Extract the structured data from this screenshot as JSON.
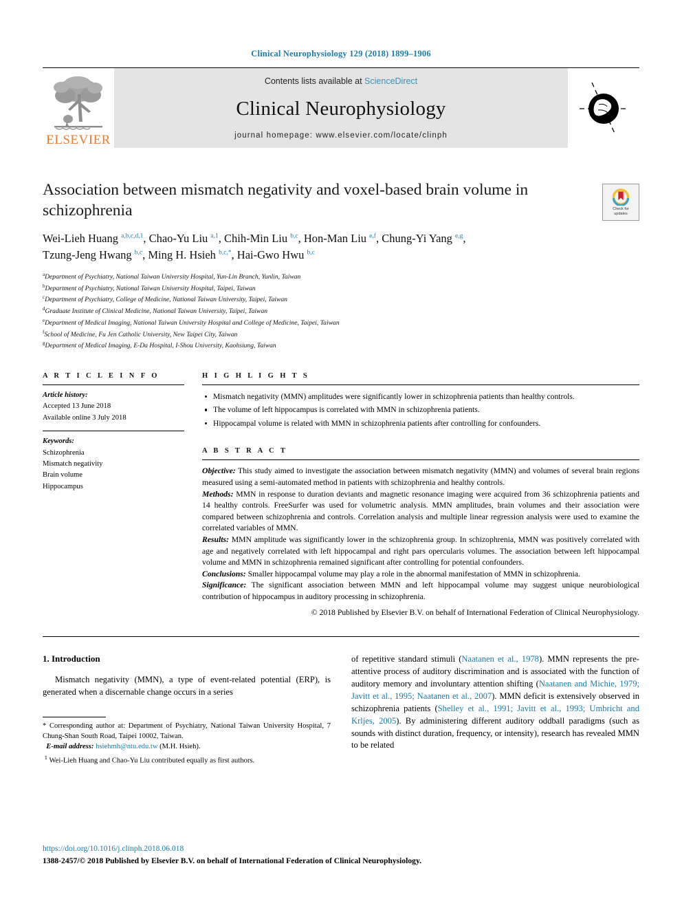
{
  "running_head": "Clinical Neurophysiology 129 (2018) 1899–1906",
  "masthead": {
    "contents_prefix": "Contents lists available at ",
    "sciencedirect": "ScienceDirect",
    "journal_title": "Clinical Neurophysiology",
    "homepage": "journal homepage: www.elsevier.com/locate/clinph",
    "publisher_name": "ELSEVIER",
    "accent_blue": "#1a7aa8",
    "elsevier_orange": "#eb7b2c",
    "masthead_bg": "#e4e4e4"
  },
  "crossmark": {
    "line1": "Check for",
    "line2": "updates"
  },
  "article": {
    "title": "Association between mismatch negativity and voxel-based brain volume in schizophrenia",
    "authors_line1": "Wei-Lieh Huang a,b,c,d,1, Chao-Yu Liu a,1, Chih-Min Liu b,c, Hon-Man Liu e,f, Chung-Yi Yang e,g,",
    "authors_line2": "Tzung-Jeng Hwang b,c, Ming H. Hsieh b,c,*, Hai-Gwo Hwu b,c",
    "authors": [
      {
        "name": "Wei-Lieh Huang",
        "sup": "a,b,c,d,1"
      },
      {
        "name": "Chao-Yu Liu",
        "sup": "a,1"
      },
      {
        "name": "Chih-Min Liu",
        "sup": "b,c"
      },
      {
        "name": "Hon-Man Liu",
        "sup": "e,f"
      },
      {
        "name": "Chung-Yi Yang",
        "sup": "e,g"
      },
      {
        "name": "Tzung-Jeng Hwang",
        "sup": "b,c"
      },
      {
        "name": "Ming H. Hsieh",
        "sup": "b,c,*"
      },
      {
        "name": "Hai-Gwo Hwu",
        "sup": "b,c"
      }
    ],
    "affiliations": [
      {
        "mark": "a",
        "text": "Department of Psychiatry, National Taiwan University Hospital, Yun-Lin Branch, Yunlin, Taiwan"
      },
      {
        "mark": "b",
        "text": "Department of Psychiatry, National Taiwan University Hospital, Taipei, Taiwan"
      },
      {
        "mark": "c",
        "text": "Department of Psychiatry, College of Medicine, National Taiwan University, Taipei, Taiwan"
      },
      {
        "mark": "d",
        "text": "Graduate Institute of Clinical Medicine, National Taiwan University, Taipei, Taiwan"
      },
      {
        "mark": "e",
        "text": "Department of Medical Imaging, National Taiwan University Hospital and College of Medicine, Taipei, Taiwan"
      },
      {
        "mark": "f",
        "text": "School of Medicine, Fu Jen Catholic University, New Taipei City, Taiwan"
      },
      {
        "mark": "g",
        "text": "Department of Medical Imaging, E-Da Hospital, I-Shou University, Kaohsiung, Taiwan"
      }
    ]
  },
  "article_info": {
    "heading": "A R T I C L E   I N F O",
    "history_label": "Article history:",
    "history_lines": [
      "Accepted 13 June 2018",
      "Available online 3 July 2018"
    ],
    "keywords_label": "Keywords:",
    "keywords": [
      "Schizophrenia",
      "Mismatch negativity",
      "Brain volume",
      "Hippocampus"
    ]
  },
  "highlights": {
    "heading": "H I G H L I G H T S",
    "items": [
      "Mismatch negativity (MMN) amplitudes were significantly lower in schizophrenia patients than healthy controls.",
      "The volume of left hippocampus is correlated with MMN in schizophrenia patients.",
      "Hippocampal volume is related with MMN in schizophrenia patients after controlling for confounders."
    ]
  },
  "abstract": {
    "heading": "A B S T R A C T",
    "sections": [
      {
        "label": "Objective:",
        "text": " This study aimed to investigate the association between mismatch negativity (MMN) and volumes of several brain regions measured using a semi-automated method in patients with schizophrenia and healthy controls."
      },
      {
        "label": "Methods:",
        "text": " MMN in response to duration deviants and magnetic resonance imaging were acquired from 36 schizophrenia patients and 14 healthy controls. FreeSurfer was used for volumetric analysis. MMN amplitudes, brain volumes and their association were compared between schizophrenia and controls. Correlation analysis and multiple linear regression analysis were used to examine the correlated variables of MMN."
      },
      {
        "label": "Results:",
        "text": " MMN amplitude was significantly lower in the schizophrenia group. In schizophrenia, MMN was positively correlated with age and negatively correlated with left hippocampal and right pars opercularis volumes. The association between left hippocampal volume and MMN in schizophrenia remained significant after controlling for potential confounders."
      },
      {
        "label": "Conclusions:",
        "text": " Smaller hippocampal volume may play a role in the abnormal manifestation of MMN in schizophrenia."
      },
      {
        "label": "Significance:",
        "text": " The significant association between MMN and left hippocampal volume may suggest unique neurobiological contribution of hippocampus in auditory processing in schizophrenia."
      }
    ],
    "copyright": "© 2018 Published by Elsevier B.V. on behalf of International Federation of Clinical Neurophysiology."
  },
  "body": {
    "section_heading": "1. Introduction",
    "left_paragraph": "Mismatch negativity (MMN), a type of event-related potential (ERP), is generated when a discernable change occurs in a series",
    "right_paragraph_parts": [
      {
        "type": "text",
        "text": "of repetitive standard stimuli ("
      },
      {
        "type": "cite",
        "text": "Naatanen et al., 1978"
      },
      {
        "type": "text",
        "text": "). MMN represents the pre-attentive process of auditory discrimination and is associated with the function of auditory memory and involuntary attention shifting ("
      },
      {
        "type": "cite",
        "text": "Naatanen and Michie, 1979; Javitt et al., 1995; Naatanen et al., 2007"
      },
      {
        "type": "text",
        "text": "). MMN deficit is extensively observed in schizophrenia patients ("
      },
      {
        "type": "cite",
        "text": "Shelley et al., 1991; Javitt et al., 1993; Umbricht and Krljes, 2005"
      },
      {
        "type": "text",
        "text": "). By administering different auditory oddball paradigms (such as sounds with distinct duration, frequency, or intensity), research has revealed MMN to be related"
      }
    ]
  },
  "footnotes": {
    "corresponding_marker": "*",
    "corresponding_text": " Corresponding author at: Department of Psychiatry, National Taiwan University Hospital, 7 Chung-Shan South Road, Taipei 10002, Taiwan.",
    "email_label": "E-mail address:",
    "email_value": "hsiehmh@ntu.edu.tw",
    "email_attrib": " (M.H. Hsieh).",
    "equal_marker": "1",
    "equal_text": " Wei-Lieh Huang and Chao-Yu Liu contributed equally as first authors."
  },
  "doi": {
    "url": "https://doi.org/10.1016/j.clinph.2018.06.018",
    "issn_line": "1388-2457/© 2018 Published by Elsevier B.V. on behalf of International Federation of Clinical Neurophysiology."
  }
}
